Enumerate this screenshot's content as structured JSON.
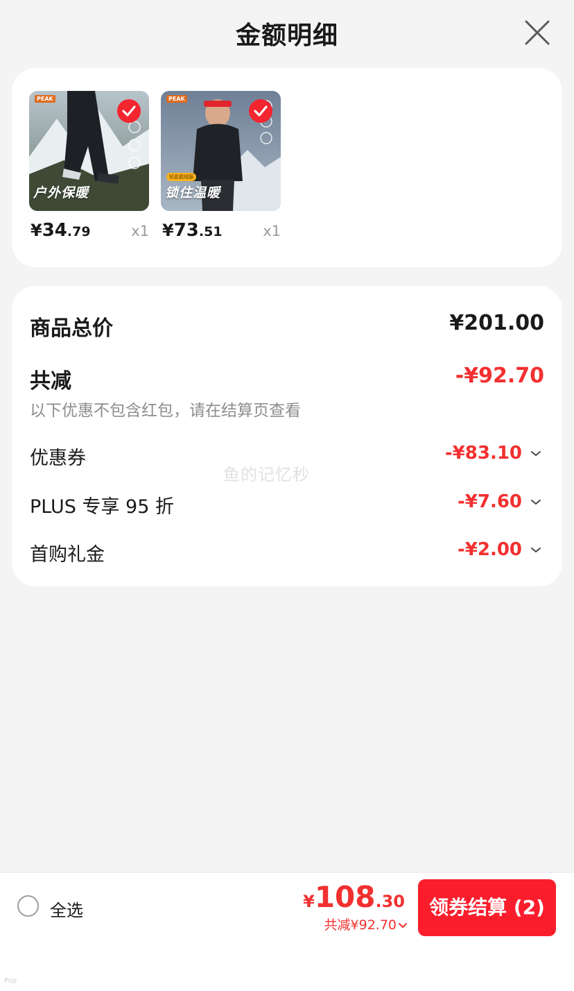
{
  "header": {
    "title": "金额明细"
  },
  "products": [
    {
      "tag": "户外保暖",
      "brand": "PEAK",
      "badge": "",
      "price_yen": "¥",
      "price_int": "34",
      "price_dec": ".79",
      "qty": "x1"
    },
    {
      "tag": "锁住温暖",
      "brand": "PEAK",
      "badge": "轻盈鹅绒服",
      "price_yen": "¥",
      "price_int": "73",
      "price_dec": ".51",
      "qty": "x1"
    }
  ],
  "summary": {
    "total_label": "商品总价",
    "total_value": "¥201.00",
    "reduce_label": "共减",
    "reduce_value": "-¥92.70",
    "note": "以下优惠不包含红包，请在结算页查看",
    "items": [
      {
        "label": "优惠券",
        "value": "-¥83.10"
      },
      {
        "label": "PLUS 专享 95 折",
        "value": "-¥7.60"
      },
      {
        "label": "首购礼金",
        "value": "-¥2.00"
      }
    ]
  },
  "watermark": "鱼的记忆秒",
  "footer": {
    "select_all": "全选",
    "total_yen": "¥",
    "total_int": "108",
    "total_dec": ".30",
    "reduce_summary": "共减¥92.70",
    "checkout_label": "领券结算 (2)"
  },
  "corner_mark": "Pop"
}
